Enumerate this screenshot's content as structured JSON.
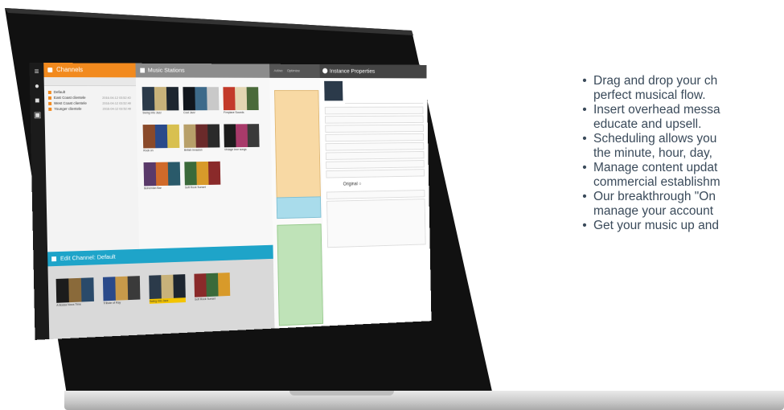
{
  "app": {
    "channels_title": "Channels",
    "music_title": "Music Stations",
    "schedule_tabs": [
      "Active",
      "Optimize"
    ],
    "props_title": "Instance Properties",
    "edit_title": "Edit Channel: Default",
    "channels": [
      {
        "name": "Default",
        "date": ""
      },
      {
        "name": "East Coast clientele",
        "date": "2016-04-12 03:52:40"
      },
      {
        "name": "West Coast clientele",
        "date": "2016-04-12 03:52:40"
      },
      {
        "name": "Younger clientele",
        "date": "2016-04-12 03:52:40"
      }
    ],
    "albums": [
      {
        "caption": "Swing into Jazz"
      },
      {
        "caption": "Cool Jazz"
      },
      {
        "caption": "Fireplace Sounds"
      },
      {
        "caption": "Rock on"
      },
      {
        "caption": "British Invasion"
      },
      {
        "caption": "Vintage love songs"
      },
      {
        "caption": "Bohemian Bar"
      },
      {
        "caption": "Soft Rock Sunset"
      }
    ],
    "edit_albums": [
      {
        "caption": "A Bossa Nova Time"
      },
      {
        "caption": "Tribute of Ray"
      },
      {
        "caption": "Swing into Jazz"
      },
      {
        "caption": "Soft Rock Sunset"
      }
    ],
    "props_original_label": "Original"
  },
  "colors": {
    "channels_header": "#f28a1e",
    "edit_header": "#1ea4c9",
    "music_header": "#8c8c8c",
    "schedule_orange": "#f8d9a4",
    "schedule_blue": "#a9dceb",
    "schedule_green": "#bfe3b8",
    "bullet_text": "#3a4a5a"
  },
  "features": [
    "Drag and drop your ch",
    "perfect musical flow.",
    "Insert overhead messa",
    "educate and upsell.",
    "Scheduling allows you",
    "the minute, hour, day,",
    "Manage content updat",
    "commercial establishm",
    "Our breakthrough \"On",
    "manage your account",
    "Get your music up and"
  ],
  "feature_bullets": [
    true,
    false,
    true,
    false,
    true,
    false,
    true,
    false,
    true,
    false,
    true
  ]
}
